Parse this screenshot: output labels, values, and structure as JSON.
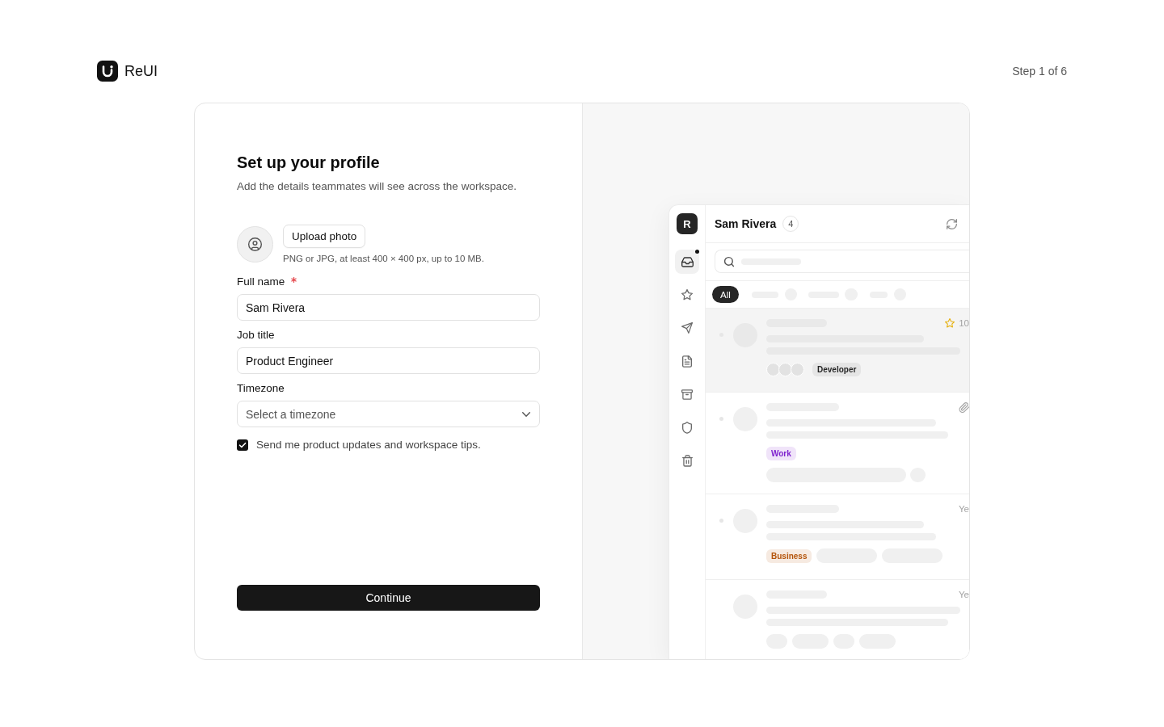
{
  "brand": {
    "name": "ReUI"
  },
  "step": "Step 1 of 6",
  "form": {
    "title": "Set up your profile",
    "subtitle": "Add the details teammates will see across the workspace.",
    "photo": {
      "button": "Upload photo",
      "hint": "PNG or JPG, at least 400 × 400 px, up to 10 MB."
    },
    "fields": [
      {
        "kind": "text",
        "label": "Full name",
        "required": true,
        "value": "Sam Rivera"
      },
      {
        "kind": "text",
        "label": "Job title",
        "required": false,
        "value": "Product Engineer"
      },
      {
        "kind": "select",
        "label": "Timezone",
        "required": false,
        "placeholder": "Select a timezone"
      }
    ],
    "checkbox": {
      "label": "Send me product updates and workspace tips.",
      "checked": true
    },
    "submit": "Continue"
  },
  "preview": {
    "avatar": "R",
    "nav": [
      {
        "selected": true,
        "unread": true
      },
      {
        "selected": false,
        "unread": false
      },
      {
        "selected": false,
        "unread": false
      },
      {
        "selected": false,
        "unread": false
      },
      {
        "selected": false,
        "unread": false
      },
      {
        "selected": false,
        "unread": false
      },
      {
        "selected": false,
        "unread": false
      }
    ],
    "header": {
      "title": "Sam Rivera",
      "count": "4"
    },
    "filters": [
      {
        "label": "All",
        "selected": true
      }
    ],
    "messages": [
      {
        "selected": true,
        "unread": true,
        "starred": true,
        "attachment": false,
        "meta": "10",
        "tags": [
          {
            "label": "Developer",
            "color": "#262626"
          }
        ]
      },
      {
        "selected": false,
        "unread": true,
        "starred": false,
        "attachment": true,
        "tags": [
          {
            "label": "Work",
            "color": "#7e22ce"
          }
        ]
      },
      {
        "selected": false,
        "unread": true,
        "starred": false,
        "attachment": false,
        "meta": "Ye",
        "tags": [
          {
            "label": "Business",
            "color": "#b45309"
          }
        ]
      },
      {
        "selected": false,
        "unread": false,
        "starred": false,
        "attachment": false,
        "meta": "Ye"
      }
    ]
  }
}
